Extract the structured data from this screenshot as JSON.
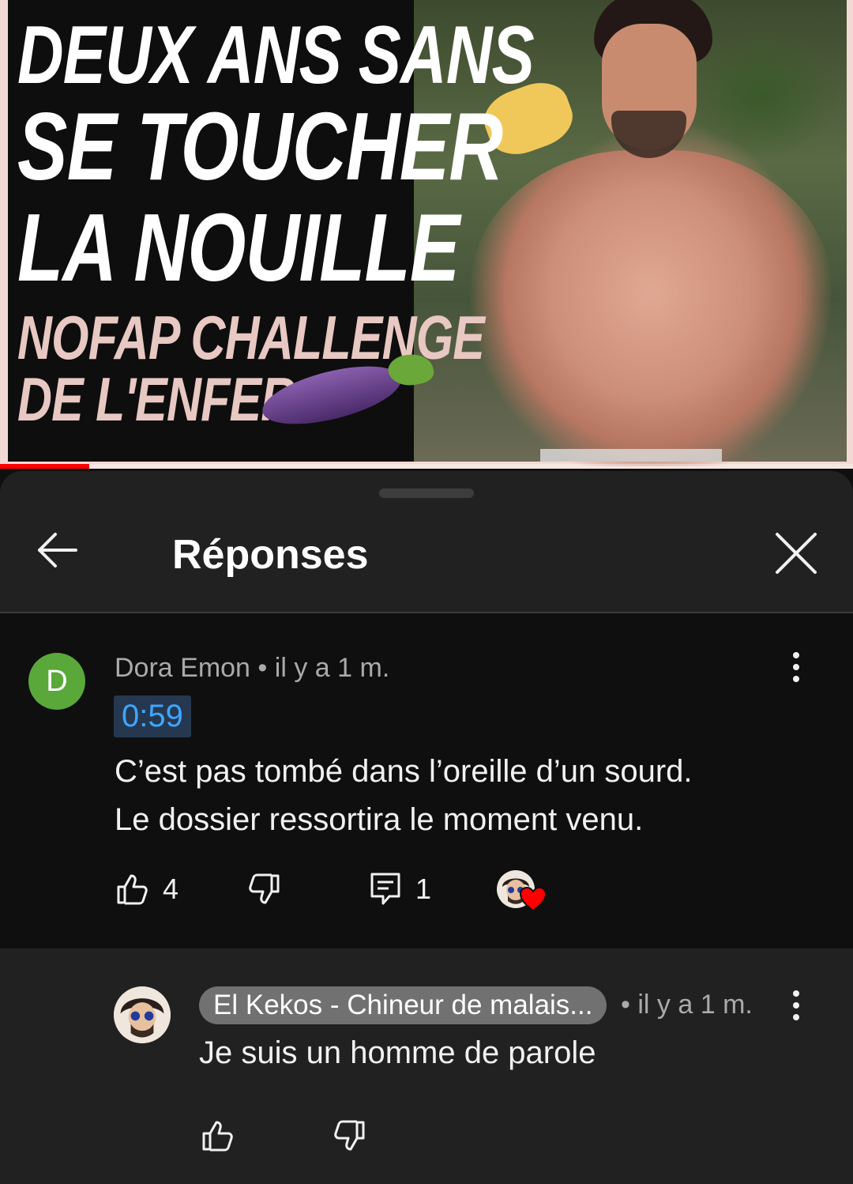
{
  "video": {
    "thumbnail": {
      "line1": "DEUX ANS SANS",
      "line2": "SE TOUCHER",
      "line3": "LA NOUILLE",
      "line4": "NOFAP CHALLENGE",
      "line5": "DE L'ENFER"
    },
    "progress_fraction": 0.105,
    "accent_color": "#ff0000"
  },
  "panel": {
    "title": "Réponses",
    "back_icon": "arrow-left-icon",
    "close_icon": "close-icon"
  },
  "parent_comment": {
    "avatar_letter": "D",
    "avatar_color": "#5aa83a",
    "author": "Dora Emon",
    "age": "il y a 1 m.",
    "timestamp_link": "0:59",
    "text_line1": "C’est pas tombé dans l’oreille d’un sourd.",
    "text_line2": "Le dossier ressortira le moment venu.",
    "like_count": "4",
    "reply_count": "1",
    "creator_heart": true
  },
  "reply": {
    "author": "El Kekos - Chineur de malais...",
    "age": "il y a 1 m.",
    "text": "Je suis un homme de parole"
  }
}
